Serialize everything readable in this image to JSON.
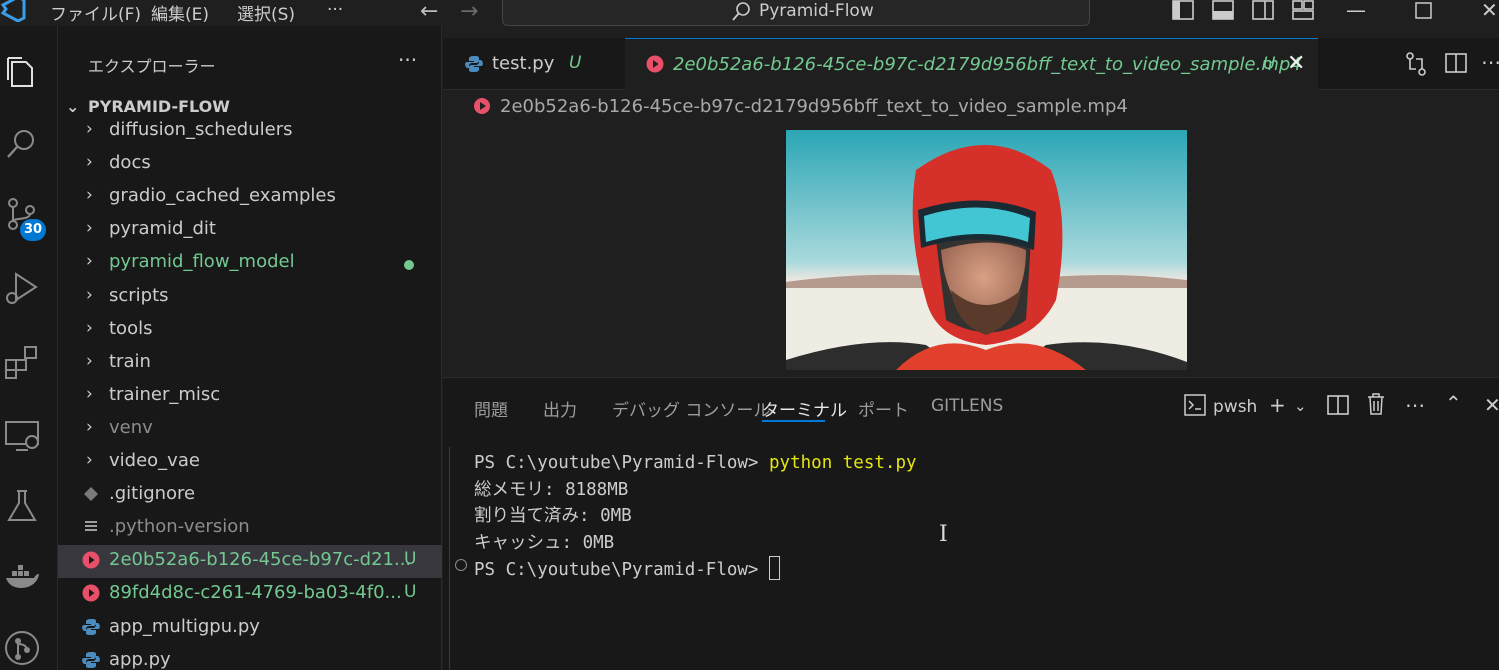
{
  "titlebar": {
    "menus": [
      "ファイル(F)",
      "編集(E)",
      "選択(S)",
      "···"
    ],
    "search_text": "Pyramid-Flow"
  },
  "activity": {
    "source_control_badge": "30"
  },
  "sidebar": {
    "title": "エクスプローラー",
    "more": "···",
    "root_label": "PYRAMID-FLOW",
    "items": [
      {
        "label": "diffusion_schedulers",
        "kind": "folder"
      },
      {
        "label": "docs",
        "kind": "folder"
      },
      {
        "label": "gradio_cached_examples",
        "kind": "folder"
      },
      {
        "label": "pyramid_dit",
        "kind": "folder"
      },
      {
        "label": "pyramid_flow_model",
        "kind": "folder",
        "modified": true
      },
      {
        "label": "scripts",
        "kind": "folder"
      },
      {
        "label": "tools",
        "kind": "folder"
      },
      {
        "label": "train",
        "kind": "folder"
      },
      {
        "label": "trainer_misc",
        "kind": "folder"
      },
      {
        "label": "venv",
        "kind": "folder",
        "dim": true
      },
      {
        "label": "video_vae",
        "kind": "folder"
      },
      {
        "label": ".gitignore",
        "kind": "git"
      },
      {
        "label": ".python-version",
        "kind": "text",
        "dim": true
      },
      {
        "label": "2e0b52a6-b126-45ce-b97c-d21...",
        "kind": "video",
        "status": "U",
        "selected": true
      },
      {
        "label": "89fd4d8c-c261-4769-ba03-4f0...",
        "kind": "video",
        "status": "U"
      },
      {
        "label": "app_multigpu.py",
        "kind": "python"
      },
      {
        "label": "app.py",
        "kind": "python"
      }
    ]
  },
  "editor": {
    "tabs": [
      {
        "label": "test.py",
        "status": "U"
      },
      {
        "label": "2e0b52a6-b126-45ce-b97c-d2179d956bff_text_to_video_sample.mp4",
        "status": "U",
        "close": "✕"
      }
    ],
    "breadcrumb": "2e0b52a6-b126-45ce-b97c-d2179d956bff_text_to_video_sample.mp4"
  },
  "panel": {
    "tabs": [
      "問題",
      "出力",
      "デバッグ コンソール",
      "ターミナル",
      "ポート",
      "GITLENS"
    ],
    "active_tab": "ターミナル",
    "shell": "pwsh",
    "terminal": {
      "prompt": "PS C:\\youtube\\Pyramid-Flow> ",
      "command": "python test.py",
      "output": [
        "総メモリ: 8188MB",
        "割り当て済み: 0MB",
        "キャッシュ: 0MB"
      ],
      "prompt2": "PS C:\\youtube\\Pyramid-Flow> "
    }
  },
  "colors": {
    "accent": "#0078d4",
    "git_untracked": "#73c991",
    "terminal_command": "#e5e510",
    "video_icon": "#e8506a"
  }
}
